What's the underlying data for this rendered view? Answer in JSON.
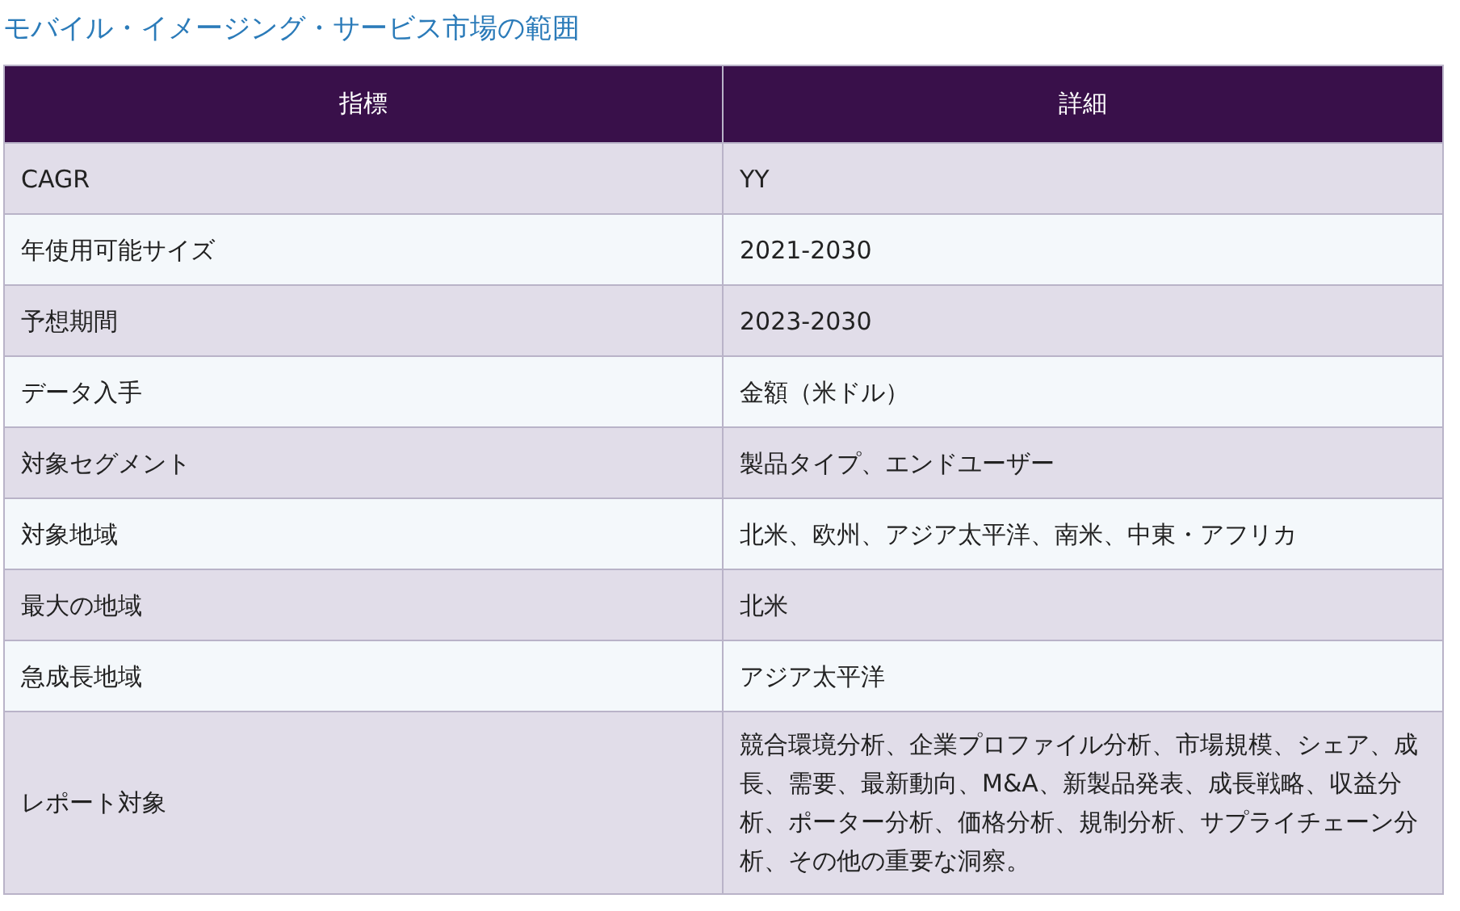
{
  "title": "モバイル・イメージング・サービス市場の範囲",
  "table": {
    "columns": [
      "指標",
      "詳細"
    ],
    "rows": [
      [
        "CAGR",
        "YY"
      ],
      [
        "年使用可能サイズ",
        "2021-2030"
      ],
      [
        "予想期間",
        "2023-2030"
      ],
      [
        "データ入手",
        "金額（米ドル）"
      ],
      [
        "対象セグメント",
        "製品タイプ、エンドユーザー"
      ],
      [
        "対象地域",
        "北米、欧州、アジア太平洋、南米、中東・アフリカ"
      ],
      [
        "最大の地域",
        "北米"
      ],
      [
        "急成長地域",
        "アジア太平洋"
      ],
      [
        "レポート対象",
        "競合環境分析、企業プロファイル分析、市場規模、シェア、成長、需要、最新動向、M&A、新製品発表、成長戦略、収益分析、ポーター分析、価格分析、規制分析、サプライチェーン分析、その他の重要な洞察。"
      ]
    ]
  }
}
